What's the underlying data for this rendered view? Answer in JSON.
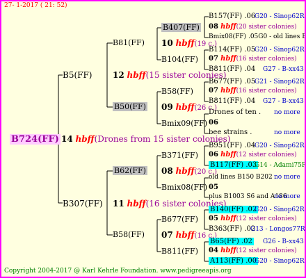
{
  "header": "27-  1-2017 ( 21: 52)",
  "footer": "Copyright 2004-2017 @ Karl Kehrle Foundation.   www.pedigreeapis.org",
  "hbff": "hbff",
  "root": {
    "id": "B724(FF)"
  },
  "gen1": {
    "num": "14",
    "note": "(Drones from 15 sister colonies)",
    "top": {
      "id": "B5(FF)",
      "num": "12",
      "note": "(15 sister colonies)"
    },
    "bot": {
      "id": "B307(FF)",
      "num": "11",
      "note": "(16 sister colonies)"
    }
  },
  "gen2": {
    "a": {
      "id": "B81(FF)",
      "num": "10",
      "note": "(19 c.)"
    },
    "b": {
      "id": "B50(FF)",
      "num": "09",
      "note": "(26 c.)"
    },
    "c": {
      "id": "B62(FF)",
      "num": "08",
      "note": "(20 c.)"
    },
    "d": {
      "id": "B58(FF)",
      "num": "07",
      "note": "(16 c.)"
    }
  },
  "gen3": [
    {
      "id": "B407(FF)",
      "num": "08",
      "note": "(20 sister colonies)"
    },
    {
      "id": "B104(FF)",
      "num": "07",
      "note": "(16 sister colonies)"
    },
    {
      "id": "B58(FF)",
      "num": "07",
      "note": "(16 sister colonies)"
    },
    {
      "id": "Bmix09(FF)",
      "num": "06",
      "note1": "Drones of ten .",
      "note2": "bee strains .",
      "more1": "no more",
      "more2": "no more"
    },
    {
      "id": "B371(FF)",
      "num": "06",
      "note": "(12 sister colonies)"
    },
    {
      "id": "Bmix08(FF)",
      "num": "05",
      "note1": "old lines B150 B202 .",
      "note2": "plus B1003 S6 and A186",
      "more1": "no more",
      "more2": "no more"
    },
    {
      "id": "B677(FF)",
      "num": "05",
      "note": "(12 sister colonies)"
    },
    {
      "id": "B811(FF)",
      "num": "04",
      "note": "(12 sister colonies)"
    }
  ],
  "gen4": [
    {
      "id": "B157(FF)",
      "num": ".06",
      "info": "G20 - Sinop62R"
    },
    {
      "id": "Bmix08(FF)",
      "num": ".05G0",
      "info": "- old lines B"
    },
    {
      "id": "B114(FF)",
      "num": ".05",
      "info": "G20 - Sinop62R"
    },
    {
      "id": "B811(FF)",
      "num": ".04",
      "info": "G27 - B-xx43"
    },
    {
      "id": "B677(FF)",
      "num": ".05",
      "info": "G21 - Sinop62R"
    },
    {
      "id": "B811(FF)",
      "num": ".04",
      "info": "G27 - B-xx43"
    },
    {
      "id": "B951(FF)",
      "num": ".04",
      "info": "G20 - Sinop62R"
    },
    {
      "id": "B117(FF)",
      "num": ".03",
      "info": "G14 - Adami75R"
    },
    {
      "id": "B140(FF)",
      "num": ".02",
      "info": "G20 - Sinop62R"
    },
    {
      "id": "B363(FF)",
      "num": ".02",
      "info": "G13 - Longos77R"
    },
    {
      "id": "B65(FF)",
      "num": ".02",
      "info": "G26 - B-xx43"
    },
    {
      "id": "A113(FF)",
      "num": ".00",
      "info": "G20 - Sinop62R"
    }
  ],
  "colors": {
    "border": "#ff00ff",
    "bg": "#ffffe0",
    "red": "#ff0000",
    "blue": "#0000cc",
    "purple": "#990099",
    "green": "#008000",
    "cyan": "#00ffff",
    "grey": "#c0c0c0",
    "pink": "#ffccff"
  }
}
